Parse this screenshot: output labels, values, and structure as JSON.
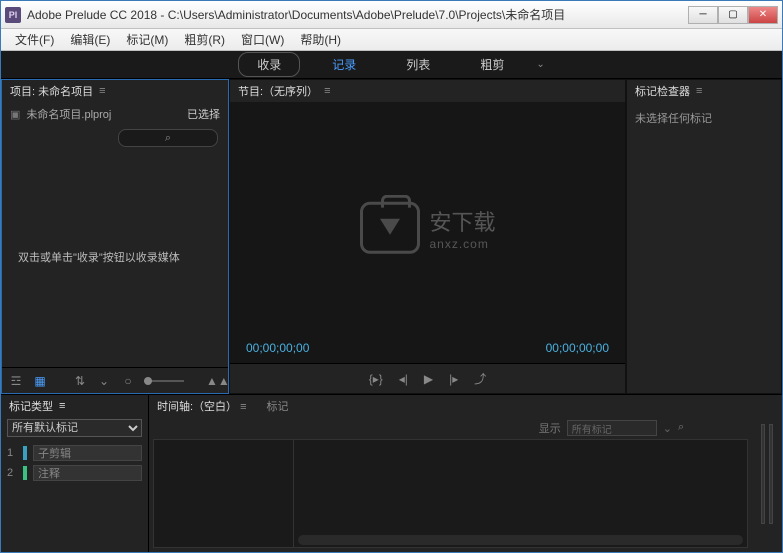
{
  "window": {
    "app_icon_text": "Pl",
    "title": "Adobe Prelude CC 2018 - C:\\Users\\Administrator\\Documents\\Adobe\\Prelude\\7.0\\Projects\\未命名项目"
  },
  "menu": {
    "file": "文件(F)",
    "edit": "编辑(E)",
    "marker": "标记(M)",
    "roughcut": "粗剪(R)",
    "window": "窗口(W)",
    "help": "帮助(H)"
  },
  "workspace_tabs": {
    "ingest": "收录",
    "logging": "记录",
    "list": "列表",
    "roughcut": "粗剪"
  },
  "project": {
    "title": "项目: 未命名项目",
    "file_name": "未命名项目.plproj",
    "status": "已选择",
    "hint": "双击或单击\"收录\"按钮以收录媒体"
  },
  "monitor": {
    "title": "节目:（无序列）",
    "tc_left": "00;00;00;00",
    "tc_right": "00;00;00;00",
    "watermark_main": "安下载",
    "watermark_sub": "anxz.com"
  },
  "marker_inspector": {
    "title": "标记检查器",
    "empty": "未选择任何标记"
  },
  "lower": {
    "marker_type_title": "标记类型",
    "all_default": "所有默认标记",
    "timeline_title": "时间轴:（空白）",
    "marker_tab": "标记",
    "filter_label": "显示",
    "filter_value": "所有标记",
    "item1": "子剪辑",
    "item2": "注释"
  }
}
